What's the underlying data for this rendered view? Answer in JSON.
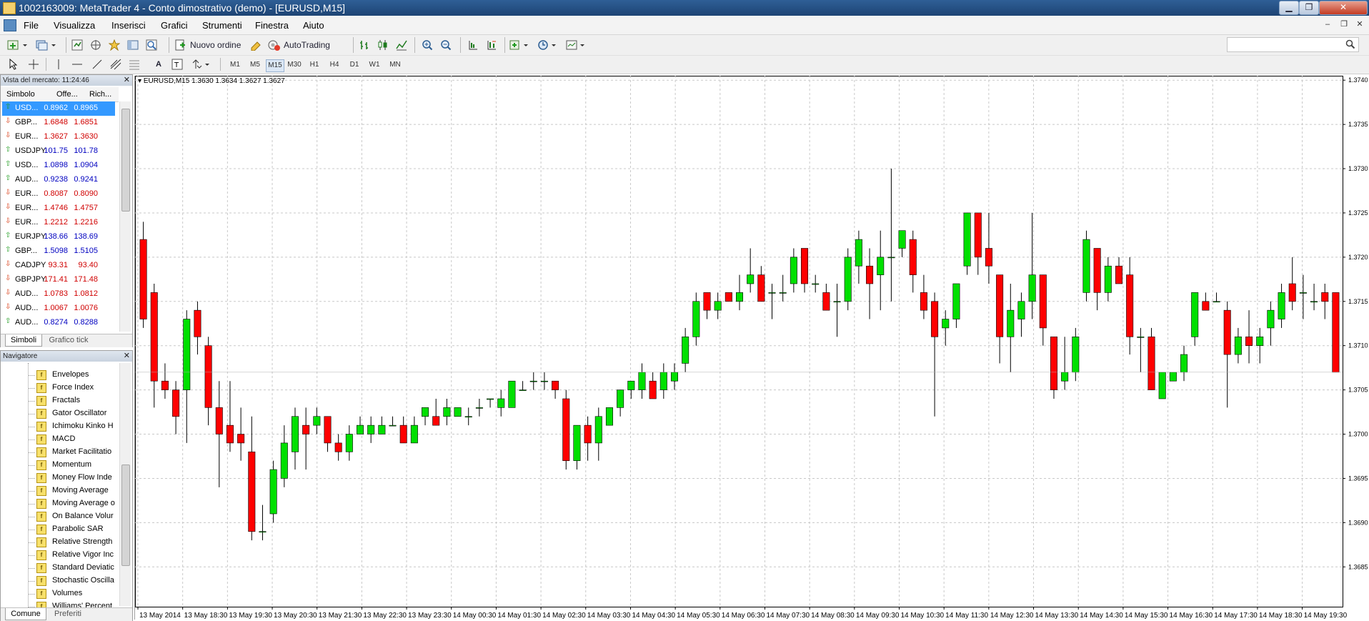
{
  "window": {
    "title": "1002163009: MetaTrader 4 - Conto dimostrativo (demo) - [EURUSD,M15]",
    "min_label": "▁",
    "max_label": "❐",
    "close_label": "✕"
  },
  "menu": {
    "items": [
      "File",
      "Visualizza",
      "Inserisci",
      "Grafici",
      "Strumenti",
      "Finestra",
      "Aiuto"
    ]
  },
  "toolbar": {
    "new_order_label": "Nuovo ordine",
    "autotrading_label": "AutoTrading",
    "timeframes": [
      "M1",
      "M5",
      "M15",
      "M30",
      "H1",
      "H4",
      "D1",
      "W1",
      "MN"
    ],
    "selected_timeframe": "M15"
  },
  "market_watch": {
    "title": "Vista del mercato: 11:24:46",
    "columns": [
      "Simbolo",
      "Offe...",
      "Rich..."
    ],
    "rows": [
      {
        "symbol": "USD...",
        "bid": "0.8962",
        "ask": "0.8965",
        "dir": "up",
        "selected": true
      },
      {
        "symbol": "GBP...",
        "bid": "1.6848",
        "ask": "1.6851",
        "dir": "down"
      },
      {
        "symbol": "EUR...",
        "bid": "1.3627",
        "ask": "1.3630",
        "dir": "down"
      },
      {
        "symbol": "USDJPY",
        "bid": "101.75",
        "ask": "101.78",
        "dir": "up"
      },
      {
        "symbol": "USD...",
        "bid": "1.0898",
        "ask": "1.0904",
        "dir": "up"
      },
      {
        "symbol": "AUD...",
        "bid": "0.9238",
        "ask": "0.9241",
        "dir": "up"
      },
      {
        "symbol": "EUR...",
        "bid": "0.8087",
        "ask": "0.8090",
        "dir": "down"
      },
      {
        "symbol": "EUR...",
        "bid": "1.4746",
        "ask": "1.4757",
        "dir": "down"
      },
      {
        "symbol": "EUR...",
        "bid": "1.2212",
        "ask": "1.2216",
        "dir": "down"
      },
      {
        "symbol": "EURJPY",
        "bid": "138.66",
        "ask": "138.69",
        "dir": "up"
      },
      {
        "symbol": "GBP...",
        "bid": "1.5098",
        "ask": "1.5105",
        "dir": "up"
      },
      {
        "symbol": "CADJPY",
        "bid": "93.31",
        "ask": "93.40",
        "dir": "down"
      },
      {
        "symbol": "GBPJPY",
        "bid": "171.41",
        "ask": "171.48",
        "dir": "down"
      },
      {
        "symbol": "AUD...",
        "bid": "1.0783",
        "ask": "1.0812",
        "dir": "down"
      },
      {
        "symbol": "AUD...",
        "bid": "1.0067",
        "ask": "1.0076",
        "dir": "down"
      },
      {
        "symbol": "AUD...",
        "bid": "0.8274",
        "ask": "0.8288",
        "dir": "up"
      }
    ],
    "tabs": [
      "Simboli",
      "Grafico tick"
    ]
  },
  "navigator": {
    "title": "Navigatore",
    "items": [
      "Envelopes",
      "Force Index",
      "Fractals",
      "Gator Oscillator",
      "Ichimoku Kinko H",
      "MACD",
      "Market Facilitatio",
      "Momentum",
      "Money Flow Inde",
      "Moving Average",
      "Moving Average o",
      "On Balance Volur",
      "Parabolic SAR",
      "Relative Strength",
      "Relative Vigor Inc",
      "Standard Deviatic",
      "Stochastic Oscilla",
      "Volumes",
      "Williams' Percent"
    ],
    "tabs": [
      "Comune",
      "Preferiti"
    ]
  },
  "chart_data": {
    "type": "candlestick",
    "title": "EURUSD,M15  1.3630 1.3634 1.3627 1.3627",
    "symbol_label": "EURUSD,M15",
    "ohlc_label": "1.3630 1.3634 1.3627 1.3627",
    "ylim": [
      1.36805,
      1.37405
    ],
    "y_ticks": [
      "1.3740",
      "1.3735",
      "1.3730",
      "1.3725",
      "1.3720",
      "1.3715",
      "1.3710",
      "1.3705",
      "1.3700",
      "1.3695",
      "1.3690",
      "1.3685"
    ],
    "x_ticks": [
      "13 May 2014",
      "13 May 18:30",
      "13 May 19:30",
      "13 May 20:30",
      "13 May 21:30",
      "13 May 22:30",
      "13 May 23:30",
      "14 May 00:30",
      "14 May 01:30",
      "14 May 02:30",
      "14 May 03:30",
      "14 May 04:30",
      "14 May 05:30",
      "14 May 06:30",
      "14 May 07:30",
      "14 May 08:30",
      "14 May 09:30",
      "14 May 10:30",
      "14 May 11:30",
      "14 May 12:30",
      "14 May 13:30",
      "14 May 14:30",
      "14 May 15:30",
      "14 May 16:30",
      "14 May 17:30",
      "14 May 18:30",
      "14 May 19:30"
    ],
    "grid": true,
    "bull_color": "#00e000",
    "bear_color": "#ff0000",
    "candles": [
      [
        1.3722,
        1.3724,
        1.3712,
        1.3713
      ],
      [
        1.3716,
        1.3717,
        1.3703,
        1.3706
      ],
      [
        1.3706,
        1.3708,
        1.3704,
        1.3705
      ],
      [
        1.3705,
        1.3706,
        1.37,
        1.3702
      ],
      [
        1.3705,
        1.3714,
        1.3699,
        1.3713
      ],
      [
        1.3714,
        1.3715,
        1.3709,
        1.3711
      ],
      [
        1.371,
        1.3711,
        1.3701,
        1.3703
      ],
      [
        1.3703,
        1.3706,
        1.3694,
        1.37
      ],
      [
        1.3701,
        1.3706,
        1.3698,
        1.3699
      ],
      [
        1.37,
        1.3703,
        1.3697,
        1.3699
      ],
      [
        1.3698,
        1.3702,
        1.3688,
        1.3689
      ],
      [
        1.3689,
        1.3692,
        1.3688,
        1.3689
      ],
      [
        1.3691,
        1.3697,
        1.369,
        1.3696
      ],
      [
        1.3695,
        1.3701,
        1.3694,
        1.3699
      ],
      [
        1.3698,
        1.3703,
        1.3696,
        1.3702
      ],
      [
        1.3701,
        1.3703,
        1.3696,
        1.37
      ],
      [
        1.3701,
        1.3703,
        1.37,
        1.3702
      ],
      [
        1.3702,
        1.3702,
        1.3698,
        1.3699
      ],
      [
        1.3699,
        1.37,
        1.3697,
        1.3698
      ],
      [
        1.3698,
        1.3701,
        1.3697,
        1.37
      ],
      [
        1.37,
        1.3702,
        1.37,
        1.3701
      ],
      [
        1.37,
        1.3702,
        1.3699,
        1.3701
      ],
      [
        1.37,
        1.3702,
        1.37,
        1.3701
      ],
      [
        1.3701,
        1.3702,
        1.3701,
        1.3701
      ],
      [
        1.3701,
        1.3702,
        1.3699,
        1.3699
      ],
      [
        1.3699,
        1.3702,
        1.3699,
        1.3701
      ],
      [
        1.3702,
        1.3703,
        1.3701,
        1.3703
      ],
      [
        1.3702,
        1.3704,
        1.3701,
        1.3701
      ],
      [
        1.3702,
        1.3704,
        1.3701,
        1.3703
      ],
      [
        1.3702,
        1.3703,
        1.3702,
        1.3703
      ],
      [
        1.3702,
        1.3703,
        1.3701,
        1.3702
      ],
      [
        1.3703,
        1.3704,
        1.3702,
        1.3703
      ],
      [
        1.3704,
        1.3704,
        1.3703,
        1.3704
      ],
      [
        1.3703,
        1.3705,
        1.3702,
        1.3704
      ],
      [
        1.3703,
        1.3706,
        1.3703,
        1.3706
      ],
      [
        1.3705,
        1.3706,
        1.3705,
        1.3705
      ],
      [
        1.3706,
        1.3707,
        1.3705,
        1.3706
      ],
      [
        1.3706,
        1.3707,
        1.3705,
        1.3706
      ],
      [
        1.3706,
        1.3706,
        1.3704,
        1.3705
      ],
      [
        1.3704,
        1.3705,
        1.3696,
        1.3697
      ],
      [
        1.3697,
        1.3701,
        1.3696,
        1.3701
      ],
      [
        1.3701,
        1.3702,
        1.3697,
        1.3699
      ],
      [
        1.3699,
        1.3703,
        1.3697,
        1.3702
      ],
      [
        1.3701,
        1.3703,
        1.3701,
        1.3703
      ],
      [
        1.3703,
        1.3705,
        1.3702,
        1.3705
      ],
      [
        1.3705,
        1.3706,
        1.3704,
        1.3706
      ],
      [
        1.3705,
        1.3708,
        1.3704,
        1.3707
      ],
      [
        1.3706,
        1.3707,
        1.3704,
        1.3704
      ],
      [
        1.3705,
        1.3708,
        1.3704,
        1.3707
      ],
      [
        1.3706,
        1.3708,
        1.3705,
        1.3707
      ],
      [
        1.3708,
        1.3712,
        1.3707,
        1.3711
      ],
      [
        1.3711,
        1.3716,
        1.371,
        1.3715
      ],
      [
        1.3716,
        1.3716,
        1.3713,
        1.3714
      ],
      [
        1.3714,
        1.3716,
        1.3713,
        1.3715
      ],
      [
        1.3716,
        1.3716,
        1.3715,
        1.3715
      ],
      [
        1.3715,
        1.3718,
        1.3714,
        1.3716
      ],
      [
        1.3717,
        1.3721,
        1.3716,
        1.3718
      ],
      [
        1.3718,
        1.3719,
        1.3715,
        1.3715
      ],
      [
        1.3716,
        1.3717,
        1.3713,
        1.3716
      ],
      [
        1.3716,
        1.3718,
        1.3715,
        1.3716
      ],
      [
        1.3717,
        1.3721,
        1.3716,
        1.372
      ],
      [
        1.3721,
        1.3721,
        1.3716,
        1.3717
      ],
      [
        1.3717,
        1.3718,
        1.3716,
        1.3717
      ],
      [
        1.3716,
        1.3717,
        1.3714,
        1.3714
      ],
      [
        1.3715,
        1.3717,
        1.3711,
        1.3715
      ],
      [
        1.3715,
        1.3721,
        1.3714,
        1.372
      ],
      [
        1.3719,
        1.3723,
        1.3717,
        1.3722
      ],
      [
        1.3719,
        1.3721,
        1.3713,
        1.3717
      ],
      [
        1.3718,
        1.3723,
        1.3714,
        1.372
      ],
      [
        1.372,
        1.373,
        1.3715,
        1.372
      ],
      [
        1.3721,
        1.3723,
        1.372,
        1.3723
      ],
      [
        1.3722,
        1.3723,
        1.3716,
        1.3718
      ],
      [
        1.3716,
        1.3718,
        1.3713,
        1.3714
      ],
      [
        1.3715,
        1.3716,
        1.3702,
        1.3711
      ],
      [
        1.3712,
        1.3714,
        1.371,
        1.3713
      ],
      [
        1.3713,
        1.3717,
        1.3712,
        1.3717
      ],
      [
        1.3719,
        1.3725,
        1.3718,
        1.3725
      ],
      [
        1.3725,
        1.3725,
        1.3718,
        1.372
      ],
      [
        1.3721,
        1.3725,
        1.3717,
        1.3719
      ],
      [
        1.3718,
        1.3718,
        1.3708,
        1.3711
      ],
      [
        1.3711,
        1.3717,
        1.3707,
        1.3714
      ],
      [
        1.3713,
        1.3716,
        1.3711,
        1.3715
      ],
      [
        1.3715,
        1.3725,
        1.3713,
        1.3718
      ],
      [
        1.3718,
        1.3718,
        1.371,
        1.3712
      ],
      [
        1.3711,
        1.3711,
        1.3704,
        1.3705
      ],
      [
        1.3706,
        1.3711,
        1.3705,
        1.3707
      ],
      [
        1.3707,
        1.3712,
        1.3706,
        1.3711
      ],
      [
        1.3716,
        1.3723,
        1.3715,
        1.3722
      ],
      [
        1.3721,
        1.3721,
        1.3714,
        1.3716
      ],
      [
        1.3716,
        1.372,
        1.3715,
        1.3719
      ],
      [
        1.3719,
        1.372,
        1.3717,
        1.3717
      ],
      [
        1.3718,
        1.372,
        1.3709,
        1.3711
      ],
      [
        1.3711,
        1.3712,
        1.3707,
        1.3711
      ],
      [
        1.3711,
        1.3712,
        1.3705,
        1.3705
      ],
      [
        1.3704,
        1.3706,
        1.3704,
        1.3707
      ],
      [
        1.3706,
        1.3707,
        1.3706,
        1.3707
      ],
      [
        1.3707,
        1.371,
        1.3706,
        1.3709
      ],
      [
        1.3711,
        1.3716,
        1.371,
        1.3716
      ],
      [
        1.3715,
        1.3716,
        1.3714,
        1.3714
      ],
      [
        1.3715,
        1.3716,
        1.3715,
        1.3715
      ],
      [
        1.3714,
        1.3715,
        1.3703,
        1.3709
      ],
      [
        1.3709,
        1.3712,
        1.3708,
        1.3711
      ],
      [
        1.3711,
        1.3714,
        1.3708,
        1.371
      ],
      [
        1.371,
        1.3712,
        1.3708,
        1.3711
      ],
      [
        1.3712,
        1.3715,
        1.371,
        1.3714
      ],
      [
        1.3713,
        1.3717,
        1.3712,
        1.3716
      ],
      [
        1.3717,
        1.372,
        1.3714,
        1.3715
      ],
      [
        1.3716,
        1.3718,
        1.3713,
        1.3716
      ],
      [
        1.3715,
        1.3717,
        1.3714,
        1.3715
      ],
      [
        1.3716,
        1.3717,
        1.3713,
        1.3715
      ],
      [
        1.3716,
        1.3716,
        1.3707,
        1.3707
      ]
    ]
  }
}
